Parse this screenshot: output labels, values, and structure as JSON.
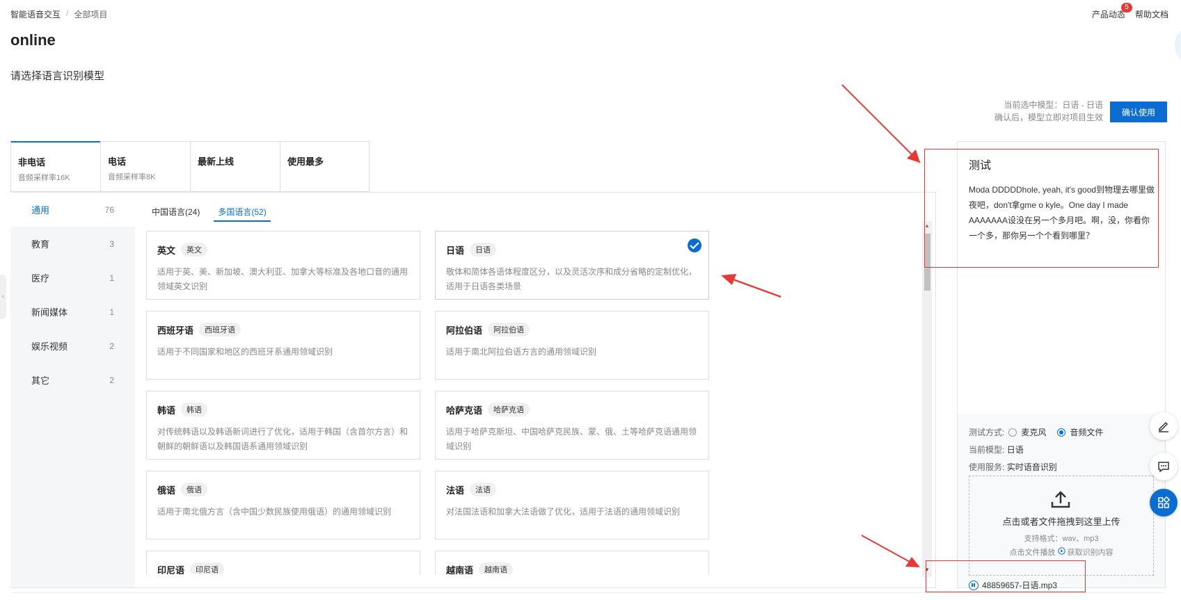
{
  "breadcrumb": {
    "root": "智能语音交互",
    "separator": "/",
    "current": "全部项目"
  },
  "top_right": {
    "product_news": "产品动态",
    "badge_count": "5",
    "help_docs": "帮助文档"
  },
  "page_title": "online",
  "subtitle": "请选择语言识别模型",
  "current_model": {
    "line1": "当前选中模型：日语 - 日语",
    "line2": "确认后，模型立即对项目生效"
  },
  "confirm_button": "确认使用",
  "main_tabs": [
    {
      "title": "非电话",
      "sub": "音频采样率16K"
    },
    {
      "title": "电话",
      "sub": "音频采样率8K"
    },
    {
      "title": "最新上线",
      "sub": ""
    },
    {
      "title": "使用最多",
      "sub": ""
    }
  ],
  "side_menu": [
    {
      "label": "通用",
      "count": "76"
    },
    {
      "label": "教育",
      "count": "3"
    },
    {
      "label": "医疗",
      "count": "1"
    },
    {
      "label": "新闻媒体",
      "count": "1"
    },
    {
      "label": "娱乐视频",
      "count": "2"
    },
    {
      "label": "其它",
      "count": "2"
    }
  ],
  "sub_tabs": [
    "中国语言(24)",
    "多国语言(52)"
  ],
  "cards": [
    {
      "name": "英文",
      "tag": "英文",
      "desc": "适用于英、美、新加坡、澳大利亚、加拿大等标准及各地口音的通用领域英文识别"
    },
    {
      "name": "日语",
      "tag": "日语",
      "desc": "敬体和简体各语体程度区分，以及灵活次序和成分省略的定制优化，适用于日语各类场景"
    },
    {
      "name": "西班牙语",
      "tag": "西班牙语",
      "desc": "适用于不同国家和地区的西班牙系通用领域识别"
    },
    {
      "name": "阿拉伯语",
      "tag": "阿拉伯语",
      "desc": "适用于南北阿拉伯语方言的通用领域识别"
    },
    {
      "name": "韩语",
      "tag": "韩语",
      "desc": "对传统韩语以及韩语新词进行了优化，适用于韩国（含首尔方言）和朝鲜的朝鲜语以及韩国语系通用领域识别"
    },
    {
      "name": "哈萨克语",
      "tag": "哈萨克语",
      "desc": "适用于哈萨克斯坦、中国哈萨克民族、蒙、俄、土等哈萨克语通用领域识别"
    },
    {
      "name": "俄语",
      "tag": "俄语",
      "desc": "适用于南北俄方言（含中国少数民族使用俄语）的通用领域识别"
    },
    {
      "name": "法语",
      "tag": "法语",
      "desc": "对法国法语和加拿大法语做了优化，适用于法语的通用领域识别"
    },
    {
      "name": "印尼语",
      "tag": "印尼语",
      "desc": ""
    },
    {
      "name": "越南语",
      "tag": "越南语",
      "desc": ""
    }
  ],
  "test_panel": {
    "title": "测试",
    "result_text": "Moda DDDDDhole, yeah, it's good到物理去哪里做夜吧，don't拿gme o kyle。One day I made AAAAAAA设没在另一个多月吧。啊，没，你看你一个多，那你另一个个看到哪里？",
    "mode_label": "测试方式:",
    "mode_mic": "麦克风",
    "mode_file": "音频文件",
    "cur_model_label": "当前模型:",
    "cur_model_value": "日语",
    "service_label": "使用服务:",
    "service_value": "实时语音识别",
    "upload_main": "点击或者文件拖拽到这里上传",
    "upload_formats": "支持格式：wav、mp3",
    "upload_hint_a": "点击文件播放",
    "upload_hint_b": "获取识别内容",
    "file_name": "48859657-日语.mp3"
  },
  "colors": {
    "accent": "#0b6cd1",
    "annotation": "#e53935",
    "badge": "#e53935"
  },
  "icons": [
    "check-icon",
    "upload-icon",
    "pause-icon",
    "edit-icon",
    "chat-icon",
    "apps-icon",
    "play-icon"
  ]
}
